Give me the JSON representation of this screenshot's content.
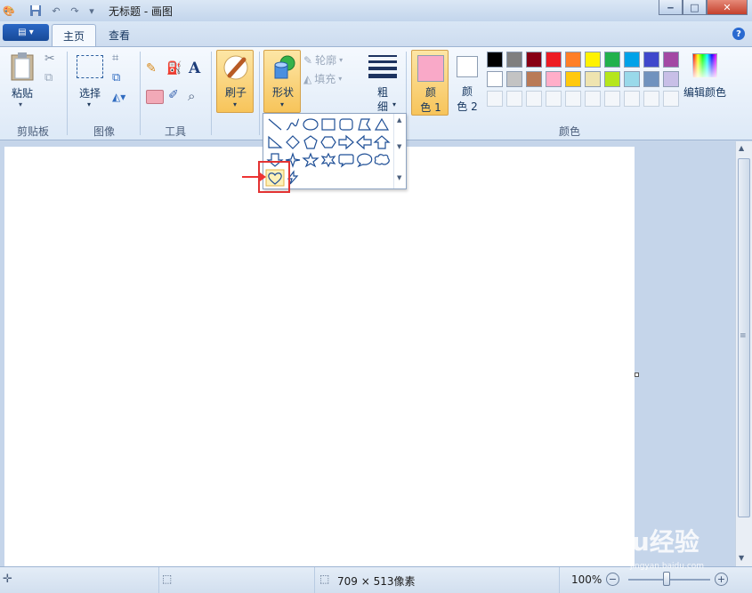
{
  "window": {
    "title": "无标题 - 画图",
    "minimize_glyph": "‒",
    "maximize_glyph": "□",
    "close_glyph": "✕"
  },
  "tabs": {
    "menu_glyph": "▤ ▾",
    "home": "主页",
    "view": "查看",
    "help_glyph": "?"
  },
  "ribbon": {
    "clipboard": {
      "paste": "粘贴",
      "group": "剪贴板"
    },
    "image": {
      "select": "选择",
      "group": "图像"
    },
    "tools": {
      "group": "工具",
      "text_glyph": "A"
    },
    "brushes": {
      "label": "刷子"
    },
    "shapes": {
      "label": "形状",
      "outline": "轮廓",
      "fill": "填充"
    },
    "size": {
      "label_line1": "粗",
      "label_line2": "细"
    },
    "colors": {
      "color1_line1": "颜",
      "color1_line2": "色 1",
      "color2_line1": "颜",
      "color2_line2": "色 2",
      "edit_colors": "编辑颜色",
      "group": "颜色",
      "color1_value": "#f9a9c8",
      "color2_value": "#ffffff",
      "palette_row1": [
        "#000000",
        "#7f7f7f",
        "#880015",
        "#ed1c24",
        "#ff7f27",
        "#fff200",
        "#22b14c",
        "#00a2e8",
        "#3f48cc",
        "#a349a4"
      ],
      "palette_row2": [
        "#ffffff",
        "#c3c3c3",
        "#b97a57",
        "#ffaec9",
        "#ffc90e",
        "#efe4b0",
        "#b5e61d",
        "#99d9ea",
        "#7092be",
        "#c8bfe7"
      ]
    }
  },
  "shapes_gallery": {
    "row1": [
      "line",
      "curve",
      "oval",
      "rectangle",
      "rounded-rectangle",
      "polygon",
      "triangle"
    ],
    "row2": [
      "right-triangle",
      "diamond",
      "pentagon",
      "hexagon",
      "right-arrow",
      "left-arrow",
      "up-arrow"
    ],
    "row3": [
      "down-arrow",
      "four-point-star",
      "five-point-star",
      "six-point-star",
      "rounded-callout",
      "oval-callout",
      "cloud-callout"
    ],
    "row4": [
      "heart",
      "lightning"
    ],
    "selected": "heart"
  },
  "annotation": {
    "highlight_color": "#e33333"
  },
  "status": {
    "canvas_size": "709 × 513像素",
    "zoom": "100%"
  },
  "watermark": {
    "text": "Baidu经验",
    "sub": "jingyan.baidu.com"
  }
}
